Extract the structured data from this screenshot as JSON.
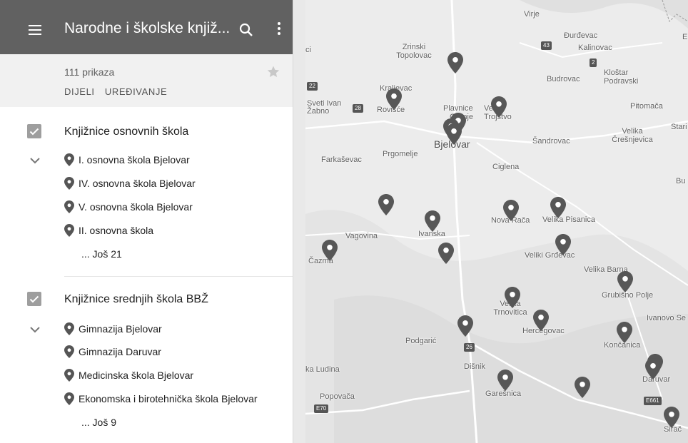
{
  "header": {
    "title": "Narodne i školske knjiž...",
    "icons": [
      "menu-icon",
      "search-icon",
      "more-vert-icon"
    ]
  },
  "info": {
    "views": "111 prikaza",
    "share_label": "DIJELI",
    "edit_label": "UREĐIVANJE"
  },
  "layers": [
    {
      "title": "Knjižnice osnovnih škola",
      "items": [
        "I. osnovna škola Bjelovar",
        "IV. osnovna škola Bjelovar",
        "V. osnovna škola Bjelovar",
        "II. osnovna škola"
      ],
      "more": "... Još 21"
    },
    {
      "title": "Knjižnice srednjih škola BBŽ",
      "items": [
        "Gimnazija Bjelovar",
        "Gimnazija Daruvar",
        "Medicinska škola Bjelovar",
        "Ekonomska i birotehnička škola Bjelovar"
      ],
      "more": "... Još 9"
    }
  ],
  "map": {
    "places": [
      "Virje",
      "Đurđevac",
      "Kalinovac",
      "Zrinski Topolovac",
      "Budrovac",
      "Kloštar Podravski",
      "Kraljevac",
      "Sveti Ivan Žabno",
      "Rovišće",
      "Plavnice",
      "Gornje",
      "Veliko Trojstvo",
      "Pitomača",
      "Stari",
      "Bjelovar",
      "Šandrovac",
      "Velika Črešnjevica",
      "Farkaševac",
      "Prgomelje",
      "Ciglena",
      "Bu",
      "Nova Rača",
      "Velika Pisanica",
      "Vagovina",
      "Ivanska",
      "Čazma",
      "Veliki Grđevac",
      "Velika Barna",
      "Grubišno Polje",
      "Velika Trnovitica",
      "Ivanovo Se",
      "Hercegovac",
      "Končanica",
      "Podgarić",
      "Dišnik",
      "ka Ludina",
      "Daruvar",
      "Garešnica",
      "Popovača",
      "Sirač",
      "ci",
      "E"
    ],
    "roads": [
      "43",
      "2",
      "22",
      "28",
      "26",
      "E661",
      "E70"
    ]
  }
}
